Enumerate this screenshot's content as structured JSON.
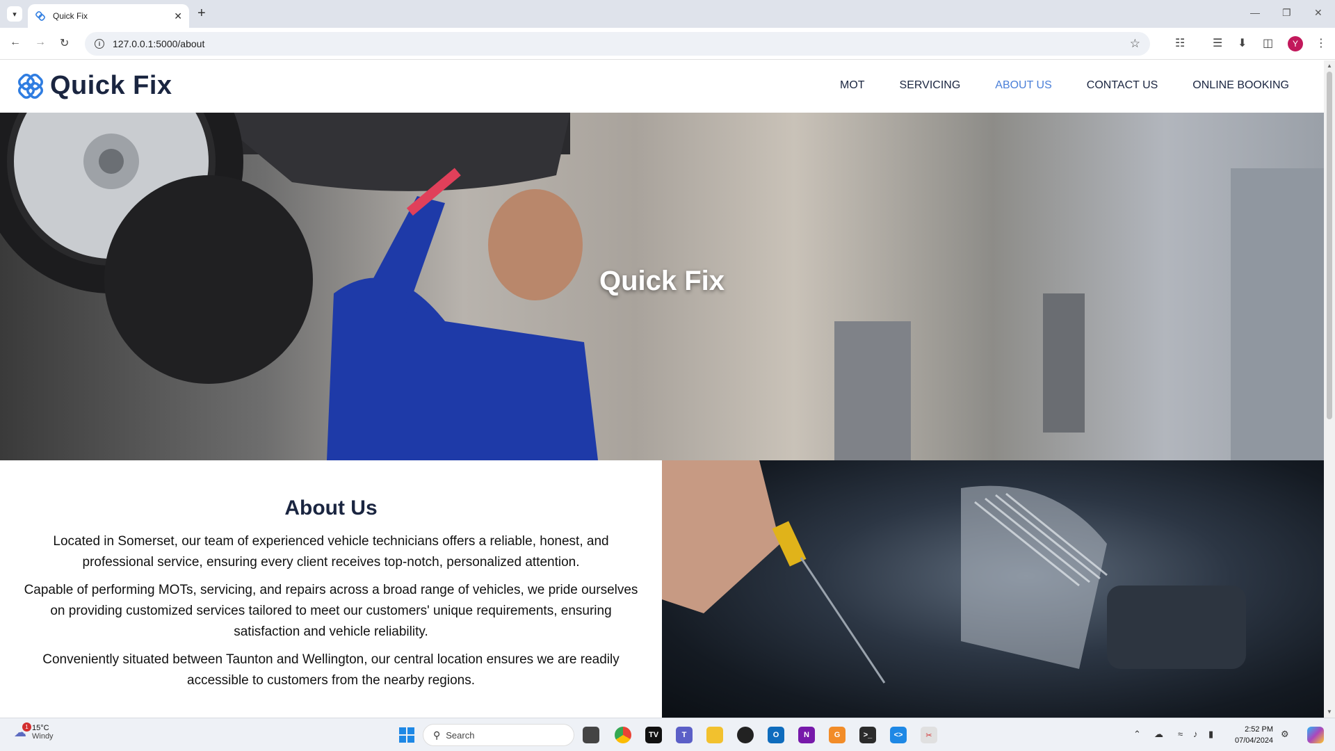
{
  "browser": {
    "tab_title": "Quick Fix",
    "url": "127.0.0.1:5000/about",
    "profile_initial": "Y"
  },
  "site": {
    "logo_text": "Quick Fix",
    "nav": [
      "MOT",
      "SERVICING",
      "ABOUT US",
      "CONTACT US",
      "ONLINE BOOKING"
    ],
    "active_nav": "ABOUT US",
    "hero_title": "Quick Fix",
    "about": {
      "heading": "About Us",
      "paragraphs": [
        "Located in Somerset, our team of experienced vehicle technicians offers a reliable, honest, and professional service, ensuring every client receives top-notch, personalized attention.",
        "Capable of performing MOTs, servicing, and repairs across a broad range of vehicles, we pride ourselves on providing customized services tailored to meet our customers' unique requirements, ensuring satisfaction and vehicle reliability.",
        "Conveniently situated between Taunton and Wellington, our central location ensures we are readily accessible to customers from the nearby regions."
      ]
    },
    "colors": {
      "brand_dark": "#1a2540",
      "nav_active": "#4a7fd8",
      "logo_blue": "#2f7de1"
    }
  },
  "taskbar": {
    "weather_temp": "15°C",
    "weather_desc": "Windy",
    "weather_badge": "1",
    "search_placeholder": "Search",
    "time": "2:52 PM",
    "date": "07/04/2024"
  }
}
